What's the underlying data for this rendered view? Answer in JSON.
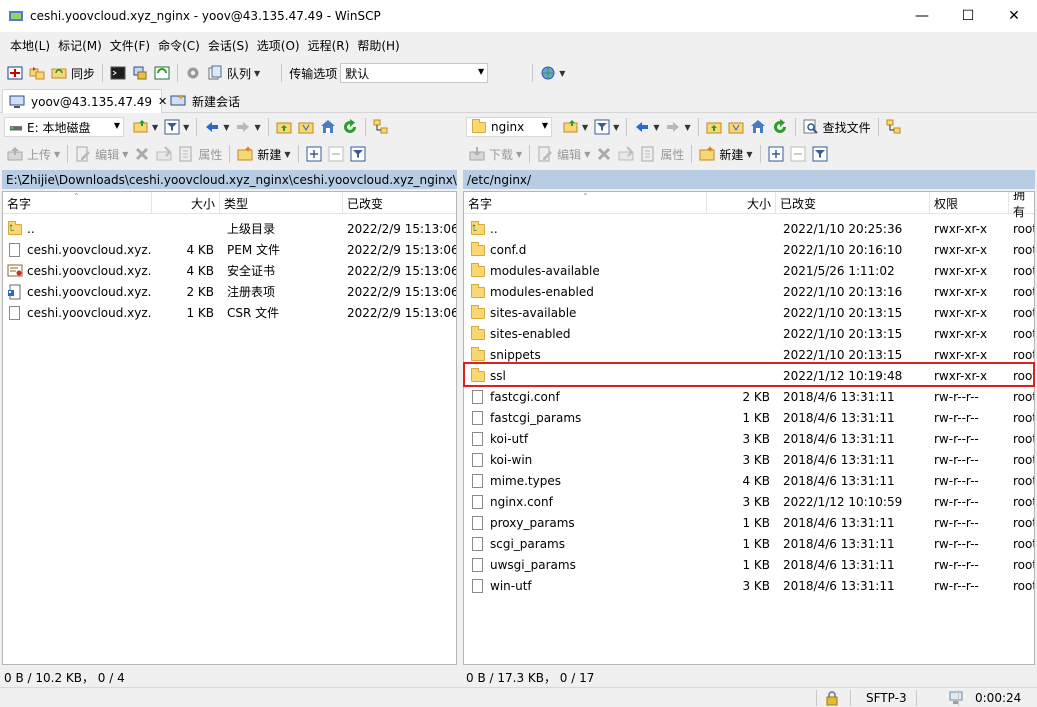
{
  "window": {
    "title": "ceshi.yoovcloud.xyz_nginx - yoov@43.135.47.49 - WinSCP",
    "controls": {
      "minimize": "—",
      "maximize": "☐",
      "close": "✕"
    }
  },
  "menu": [
    "本地(L)",
    "标记(M)",
    "文件(F)",
    "命令(C)",
    "会话(S)",
    "选项(O)",
    "远程(R)",
    "帮助(H)"
  ],
  "main_toolbar": {
    "sync": "同步",
    "queue": "队列",
    "transfer_options_label": "传输选项",
    "transfer_options_value": "默认"
  },
  "tabs": {
    "session": "yoov@43.135.47.49",
    "session_close": "✕",
    "new_session": "新建会话"
  },
  "local": {
    "drive": "E: 本地磁盘",
    "upload": "上传",
    "edit": "编辑",
    "properties": "属性",
    "new": "新建",
    "path": "E:\\Zhijie\\Downloads\\ceshi.yoovcloud.xyz_nginx\\ceshi.yoovcloud.xyz_nginx\\",
    "columns": {
      "name": "名字",
      "size": "大小",
      "type": "类型",
      "changed": "已改变"
    },
    "files": [
      {
        "name": "..",
        "size": "",
        "type": "上级目录",
        "changed": "2022/2/9   15:13:06",
        "icon": "parent-folder"
      },
      {
        "name": "ceshi.yoovcloud.xyz...",
        "size": "4 KB",
        "type": "PEM 文件",
        "changed": "2022/2/9   15:13:06",
        "icon": "file"
      },
      {
        "name": "ceshi.yoovcloud.xyz...",
        "size": "4 KB",
        "type": "安全证书",
        "changed": "2022/2/9   15:13:06",
        "icon": "certificate"
      },
      {
        "name": "ceshi.yoovcloud.xyz...",
        "size": "2 KB",
        "type": "注册表项",
        "changed": "2022/2/9   15:13:06",
        "icon": "registry"
      },
      {
        "name": "ceshi.yoovcloud.xyz...",
        "size": "1 KB",
        "type": "CSR 文件",
        "changed": "2022/2/9   15:13:06",
        "icon": "file"
      }
    ],
    "status": "0 B / 10.2 KB，  0 / 4"
  },
  "remote": {
    "folder": "nginx",
    "find_files": "查找文件",
    "download": "下载",
    "edit": "编辑",
    "properties": "属性",
    "new": "新建",
    "path": "/etc/nginx/",
    "columns": {
      "name": "名字",
      "size": "大小",
      "changed": "已改变",
      "rights": "权限",
      "owner": "拥有"
    },
    "files": [
      {
        "name": "..",
        "size": "",
        "changed": "2022/1/10 20:25:36",
        "rights": "rwxr-xr-x",
        "owner": "root",
        "icon": "parent-folder"
      },
      {
        "name": "conf.d",
        "size": "",
        "changed": "2022/1/10 20:16:10",
        "rights": "rwxr-xr-x",
        "owner": "root",
        "icon": "folder"
      },
      {
        "name": "modules-available",
        "size": "",
        "changed": "2021/5/26 1:11:02",
        "rights": "rwxr-xr-x",
        "owner": "root",
        "icon": "folder"
      },
      {
        "name": "modules-enabled",
        "size": "",
        "changed": "2022/1/10 20:13:16",
        "rights": "rwxr-xr-x",
        "owner": "root",
        "icon": "folder"
      },
      {
        "name": "sites-available",
        "size": "",
        "changed": "2022/1/10 20:13:15",
        "rights": "rwxr-xr-x",
        "owner": "root",
        "icon": "folder"
      },
      {
        "name": "sites-enabled",
        "size": "",
        "changed": "2022/1/10 20:13:15",
        "rights": "rwxr-xr-x",
        "owner": "root",
        "icon": "folder"
      },
      {
        "name": "snippets",
        "size": "",
        "changed": "2022/1/10 20:13:15",
        "rights": "rwxr-xr-x",
        "owner": "root",
        "icon": "folder"
      },
      {
        "name": "ssl",
        "size": "",
        "changed": "2022/1/12 10:19:48",
        "rights": "rwxr-xr-x",
        "owner": "root",
        "icon": "folder",
        "highlighted": true
      },
      {
        "name": "fastcgi.conf",
        "size": "2 KB",
        "changed": "2018/4/6 13:31:11",
        "rights": "rw-r--r--",
        "owner": "root",
        "icon": "file"
      },
      {
        "name": "fastcgi_params",
        "size": "1 KB",
        "changed": "2018/4/6 13:31:11",
        "rights": "rw-r--r--",
        "owner": "root",
        "icon": "file"
      },
      {
        "name": "koi-utf",
        "size": "3 KB",
        "changed": "2018/4/6 13:31:11",
        "rights": "rw-r--r--",
        "owner": "root",
        "icon": "file"
      },
      {
        "name": "koi-win",
        "size": "3 KB",
        "changed": "2018/4/6 13:31:11",
        "rights": "rw-r--r--",
        "owner": "root",
        "icon": "file"
      },
      {
        "name": "mime.types",
        "size": "4 KB",
        "changed": "2018/4/6 13:31:11",
        "rights": "rw-r--r--",
        "owner": "root",
        "icon": "file"
      },
      {
        "name": "nginx.conf",
        "size": "3 KB",
        "changed": "2022/1/12 10:10:59",
        "rights": "rw-r--r--",
        "owner": "root",
        "icon": "file"
      },
      {
        "name": "proxy_params",
        "size": "1 KB",
        "changed": "2018/4/6 13:31:11",
        "rights": "rw-r--r--",
        "owner": "root",
        "icon": "file"
      },
      {
        "name": "scgi_params",
        "size": "1 KB",
        "changed": "2018/4/6 13:31:11",
        "rights": "rw-r--r--",
        "owner": "root",
        "icon": "file"
      },
      {
        "name": "uwsgi_params",
        "size": "1 KB",
        "changed": "2018/4/6 13:31:11",
        "rights": "rw-r--r--",
        "owner": "root",
        "icon": "file"
      },
      {
        "name": "win-utf",
        "size": "3 KB",
        "changed": "2018/4/6 13:31:11",
        "rights": "rw-r--r--",
        "owner": "root",
        "icon": "file"
      }
    ],
    "status": "0 B / 17.3 KB，  0 / 17"
  },
  "statusbar": {
    "protocol": "SFTP-3",
    "elapsed": "0:00:24"
  },
  "colors": {
    "path_bar": "#b8cce4",
    "highlight": "#e02020",
    "folder": "#f8d775"
  }
}
